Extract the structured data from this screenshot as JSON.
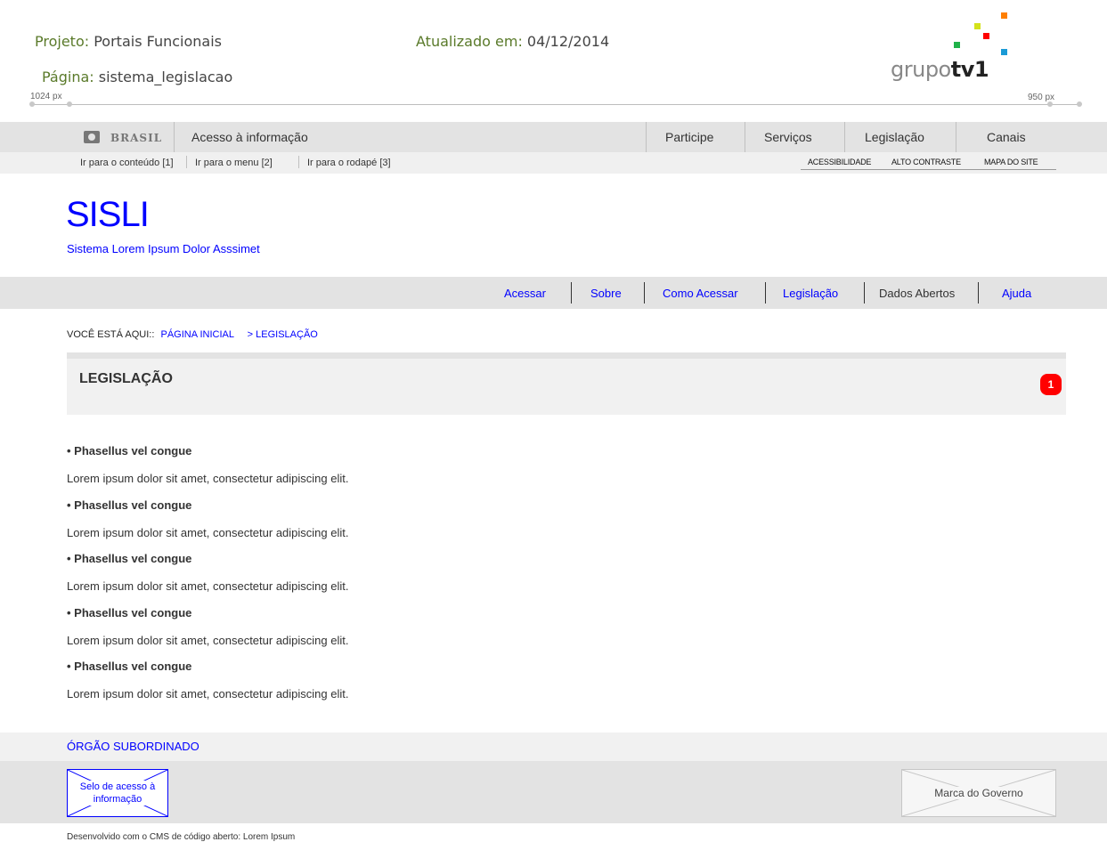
{
  "wireframe": {
    "project_label": "Projeto:",
    "project_value": "Portais Funcionais",
    "page_label": "Página:",
    "page_value": "sistema_legislacao",
    "updated_label": "Atualizado em:",
    "updated_value": "04/12/2014",
    "ruler_left": "1024 px",
    "ruler_right": "950 px",
    "logo": {
      "light": "grupo",
      "bold": "tv1"
    }
  },
  "gov_bar": {
    "brasil": "BRASIL",
    "acesso": "Acesso à informação",
    "links": [
      "Participe",
      "Serviços",
      "Legislação",
      "Canais"
    ],
    "skip_links": [
      "Ir para o conteúdo [1]",
      "Ir para o menu [2]",
      "Ir para o rodapé [3]"
    ],
    "utility_links": [
      "ACESSIBILIDADE",
      "ALTO CONTRASTE",
      "MAPA DO SITE"
    ]
  },
  "site": {
    "title": "SISLI",
    "subtitle": "Sistema Lorem Ipsum Dolor Asssimet"
  },
  "menu": [
    "Acessar",
    "Sobre",
    "Como Acessar",
    "Legislação",
    "Dados Abertos",
    "Ajuda"
  ],
  "breadcrumb": {
    "label": "VOCÊ ESTÁ AQUI::",
    "home": "PÁGINA INICIAL",
    "current": "> LEGISLAÇÃO"
  },
  "content": {
    "title": "LEGISLAÇÃO",
    "badge": "1",
    "items": [
      {
        "title": "• Phasellus vel congue",
        "text": "Lorem ipsum dolor sit amet, consectetur adipiscing elit."
      },
      {
        "title": "• Phasellus vel congue",
        "text": "Lorem ipsum dolor sit amet, consectetur adipiscing elit."
      },
      {
        "title": "• Phasellus vel congue",
        "text": "Lorem ipsum dolor sit amet, consectetur adipiscing elit."
      },
      {
        "title": "• Phasellus vel congue",
        "text": "Lorem ipsum dolor sit amet, consectetur adipiscing elit."
      },
      {
        "title": "• Phasellus vel congue",
        "text": "Lorem ipsum dolor sit amet, consectetur adipiscing elit."
      }
    ]
  },
  "footer": {
    "orgao": "ÓRGÃO SUBORDINADO",
    "selo": "Selo de acesso à informação",
    "marca": "Marca do Governo",
    "desenvolvido": "Desenvolvido com o CMS de código aberto: Lorem Ipsum"
  },
  "colors": {
    "link_blue": "#0000ff",
    "badge_red": "#ff0000",
    "bar_gray": "#e3e3e3",
    "logo_squares": [
      "#ff7f00",
      "#d4e21a",
      "#ff0000",
      "#21b24a",
      "#1a9ad6"
    ]
  }
}
